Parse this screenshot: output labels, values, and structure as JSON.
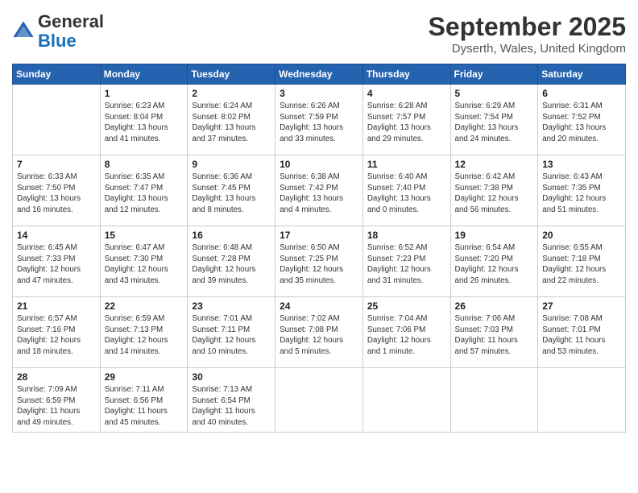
{
  "header": {
    "logo_line1": "General",
    "logo_line2": "Blue",
    "month": "September 2025",
    "location": "Dyserth, Wales, United Kingdom"
  },
  "weekdays": [
    "Sunday",
    "Monday",
    "Tuesday",
    "Wednesday",
    "Thursday",
    "Friday",
    "Saturday"
  ],
  "weeks": [
    [
      {
        "day": "",
        "info": ""
      },
      {
        "day": "1",
        "info": "Sunrise: 6:23 AM\nSunset: 8:04 PM\nDaylight: 13 hours\nand 41 minutes."
      },
      {
        "day": "2",
        "info": "Sunrise: 6:24 AM\nSunset: 8:02 PM\nDaylight: 13 hours\nand 37 minutes."
      },
      {
        "day": "3",
        "info": "Sunrise: 6:26 AM\nSunset: 7:59 PM\nDaylight: 13 hours\nand 33 minutes."
      },
      {
        "day": "4",
        "info": "Sunrise: 6:28 AM\nSunset: 7:57 PM\nDaylight: 13 hours\nand 29 minutes."
      },
      {
        "day": "5",
        "info": "Sunrise: 6:29 AM\nSunset: 7:54 PM\nDaylight: 13 hours\nand 24 minutes."
      },
      {
        "day": "6",
        "info": "Sunrise: 6:31 AM\nSunset: 7:52 PM\nDaylight: 13 hours\nand 20 minutes."
      }
    ],
    [
      {
        "day": "7",
        "info": "Sunrise: 6:33 AM\nSunset: 7:50 PM\nDaylight: 13 hours\nand 16 minutes."
      },
      {
        "day": "8",
        "info": "Sunrise: 6:35 AM\nSunset: 7:47 PM\nDaylight: 13 hours\nand 12 minutes."
      },
      {
        "day": "9",
        "info": "Sunrise: 6:36 AM\nSunset: 7:45 PM\nDaylight: 13 hours\nand 8 minutes."
      },
      {
        "day": "10",
        "info": "Sunrise: 6:38 AM\nSunset: 7:42 PM\nDaylight: 13 hours\nand 4 minutes."
      },
      {
        "day": "11",
        "info": "Sunrise: 6:40 AM\nSunset: 7:40 PM\nDaylight: 13 hours\nand 0 minutes."
      },
      {
        "day": "12",
        "info": "Sunrise: 6:42 AM\nSunset: 7:38 PM\nDaylight: 12 hours\nand 56 minutes."
      },
      {
        "day": "13",
        "info": "Sunrise: 6:43 AM\nSunset: 7:35 PM\nDaylight: 12 hours\nand 51 minutes."
      }
    ],
    [
      {
        "day": "14",
        "info": "Sunrise: 6:45 AM\nSunset: 7:33 PM\nDaylight: 12 hours\nand 47 minutes."
      },
      {
        "day": "15",
        "info": "Sunrise: 6:47 AM\nSunset: 7:30 PM\nDaylight: 12 hours\nand 43 minutes."
      },
      {
        "day": "16",
        "info": "Sunrise: 6:48 AM\nSunset: 7:28 PM\nDaylight: 12 hours\nand 39 minutes."
      },
      {
        "day": "17",
        "info": "Sunrise: 6:50 AM\nSunset: 7:25 PM\nDaylight: 12 hours\nand 35 minutes."
      },
      {
        "day": "18",
        "info": "Sunrise: 6:52 AM\nSunset: 7:23 PM\nDaylight: 12 hours\nand 31 minutes."
      },
      {
        "day": "19",
        "info": "Sunrise: 6:54 AM\nSunset: 7:20 PM\nDaylight: 12 hours\nand 26 minutes."
      },
      {
        "day": "20",
        "info": "Sunrise: 6:55 AM\nSunset: 7:18 PM\nDaylight: 12 hours\nand 22 minutes."
      }
    ],
    [
      {
        "day": "21",
        "info": "Sunrise: 6:57 AM\nSunset: 7:16 PM\nDaylight: 12 hours\nand 18 minutes."
      },
      {
        "day": "22",
        "info": "Sunrise: 6:59 AM\nSunset: 7:13 PM\nDaylight: 12 hours\nand 14 minutes."
      },
      {
        "day": "23",
        "info": "Sunrise: 7:01 AM\nSunset: 7:11 PM\nDaylight: 12 hours\nand 10 minutes."
      },
      {
        "day": "24",
        "info": "Sunrise: 7:02 AM\nSunset: 7:08 PM\nDaylight: 12 hours\nand 5 minutes."
      },
      {
        "day": "25",
        "info": "Sunrise: 7:04 AM\nSunset: 7:06 PM\nDaylight: 12 hours\nand 1 minute."
      },
      {
        "day": "26",
        "info": "Sunrise: 7:06 AM\nSunset: 7:03 PM\nDaylight: 11 hours\nand 57 minutes."
      },
      {
        "day": "27",
        "info": "Sunrise: 7:08 AM\nSunset: 7:01 PM\nDaylight: 11 hours\nand 53 minutes."
      }
    ],
    [
      {
        "day": "28",
        "info": "Sunrise: 7:09 AM\nSunset: 6:59 PM\nDaylight: 11 hours\nand 49 minutes."
      },
      {
        "day": "29",
        "info": "Sunrise: 7:11 AM\nSunset: 6:56 PM\nDaylight: 11 hours\nand 45 minutes."
      },
      {
        "day": "30",
        "info": "Sunrise: 7:13 AM\nSunset: 6:54 PM\nDaylight: 11 hours\nand 40 minutes."
      },
      {
        "day": "",
        "info": ""
      },
      {
        "day": "",
        "info": ""
      },
      {
        "day": "",
        "info": ""
      },
      {
        "day": "",
        "info": ""
      }
    ]
  ]
}
